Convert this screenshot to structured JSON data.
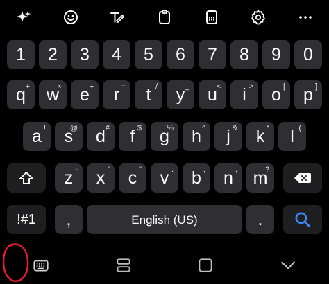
{
  "toolbar": {
    "icons": [
      "sparkle-icon",
      "emoji-icon",
      "handwriting-icon",
      "clipboard-icon",
      "keyboard-mode-icon",
      "settings-icon",
      "more-icon"
    ]
  },
  "rows": {
    "numbers": [
      "1",
      "2",
      "3",
      "4",
      "5",
      "6",
      "7",
      "8",
      "9",
      "0"
    ],
    "row1": [
      {
        "main": "q",
        "sub": "+"
      },
      {
        "main": "w",
        "sub": "×"
      },
      {
        "main": "e",
        "sub": "÷"
      },
      {
        "main": "r",
        "sub": "="
      },
      {
        "main": "t",
        "sub": "/"
      },
      {
        "main": "y",
        "sub": "_"
      },
      {
        "main": "u",
        "sub": "<"
      },
      {
        "main": "i",
        "sub": ">"
      },
      {
        "main": "o",
        "sub": "["
      },
      {
        "main": "p",
        "sub": "]"
      }
    ],
    "row2": [
      {
        "main": "a",
        "sub": "!"
      },
      {
        "main": "s",
        "sub": "@"
      },
      {
        "main": "d",
        "sub": "#"
      },
      {
        "main": "f",
        "sub": "$"
      },
      {
        "main": "g",
        "sub": "%"
      },
      {
        "main": "h",
        "sub": "^"
      },
      {
        "main": "j",
        "sub": "&"
      },
      {
        "main": "k",
        "sub": "*"
      },
      {
        "main": "l",
        "sub": "("
      }
    ],
    "row3": [
      {
        "main": "z",
        "sub": "-"
      },
      {
        "main": "x",
        "sub": "'"
      },
      {
        "main": "c",
        "sub": "\""
      },
      {
        "main": "v",
        "sub": ":"
      },
      {
        "main": "b",
        "sub": ";"
      },
      {
        "main": "n",
        "sub": ","
      },
      {
        "main": "m",
        "sub": "?"
      }
    ]
  },
  "bottom": {
    "symbols_label": "!#1",
    "comma_label": ",",
    "space_label": "English (US)",
    "period_label": "."
  },
  "colors": {
    "key": "#2f2f33",
    "function_key": "#1f1f22",
    "search_accent": "#3d8af7",
    "annotation": "#e0202a"
  }
}
